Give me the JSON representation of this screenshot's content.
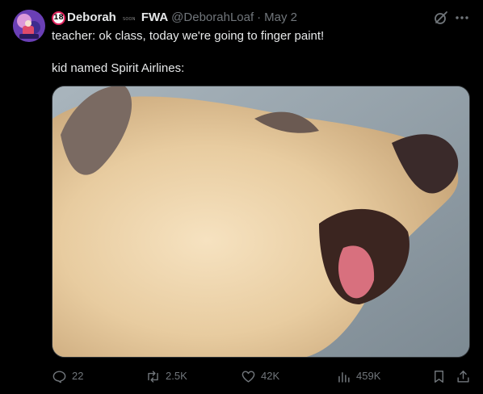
{
  "author": {
    "badge": "18",
    "name": "Deborah",
    "soon_label": "SOON",
    "name_suffix": "FWA",
    "handle": "@DeborahLoaf",
    "separator": "·",
    "date": "May 2"
  },
  "tweet": {
    "line1": "teacher: ok class, today we're going to finger paint!",
    "line2": "kid named Spirit Airlines:"
  },
  "actions": {
    "replies": "22",
    "reposts": "2.5K",
    "likes": "42K",
    "views": "459K"
  },
  "icons": {
    "grok": "grok-icon",
    "more": "more-icon",
    "reply": "reply-icon",
    "repost": "repost-icon",
    "like": "heart-icon",
    "views": "views-icon",
    "bookmark": "bookmark-icon",
    "share": "share-icon"
  },
  "colors": {
    "background": "#000000",
    "text": "#e7e9ea",
    "secondary": "#71767b",
    "badge_red": "#e0245e"
  }
}
